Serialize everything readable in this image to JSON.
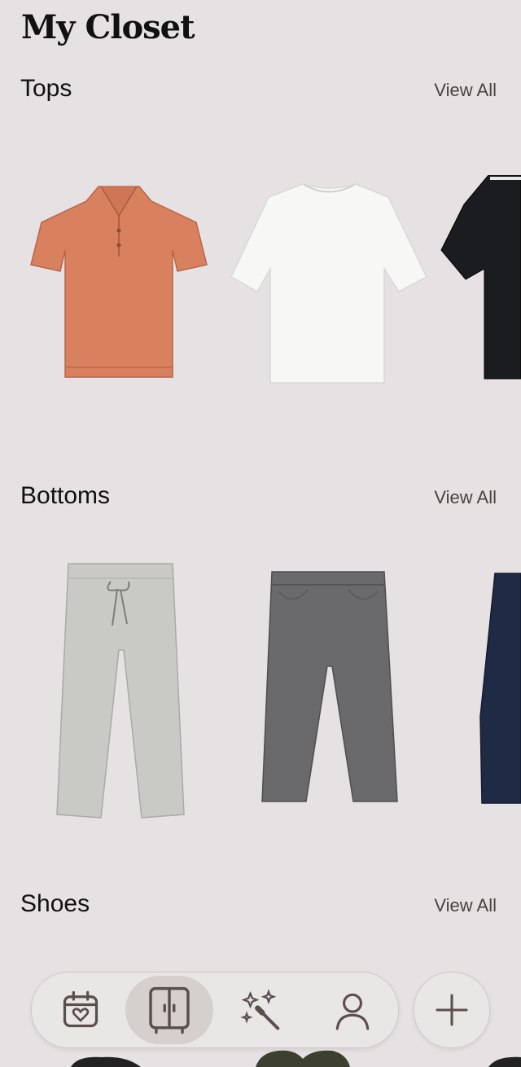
{
  "page": {
    "title": "My Closet"
  },
  "sections": [
    {
      "name": "Tops",
      "view_all": "View All"
    },
    {
      "name": "Bottoms",
      "view_all": "View All"
    },
    {
      "name": "Shoes",
      "view_all": "View All"
    }
  ],
  "tops": [
    {
      "kind": "polo shirt",
      "color": "#d9805e"
    },
    {
      "kind": "t-shirt",
      "color": "#f7f7f5"
    },
    {
      "kind": "knit polo",
      "color": "#1b1c20"
    }
  ],
  "bottoms": [
    {
      "kind": "drawstring trousers",
      "color": "#c9cac6"
    },
    {
      "kind": "jeans",
      "color": "#6a6a6c"
    },
    {
      "kind": "chinos",
      "color": "#1f2a44"
    }
  ],
  "nav": {
    "items": [
      {
        "icon": "calendar-heart-icon"
      },
      {
        "icon": "wardrobe-icon",
        "active": true
      },
      {
        "icon": "magic-wand-icon"
      },
      {
        "icon": "user-icon"
      }
    ],
    "add_icon": "plus-icon",
    "icon_color": "#5a4f4c"
  }
}
